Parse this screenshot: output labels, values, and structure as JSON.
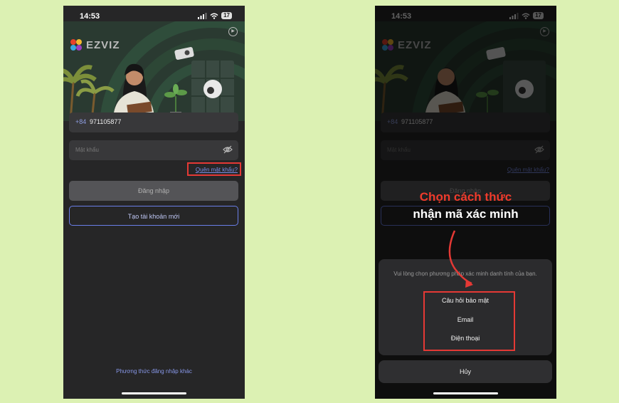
{
  "status": {
    "time": "14:53",
    "battery": "17"
  },
  "brand": {
    "name": "EZVIZ"
  },
  "login": {
    "country_code": "+84",
    "phone_number": "971105877",
    "password_placeholder": "Mật khẩu",
    "forgot_password": "Quên mật khẩu?",
    "login_button": "Đăng nhập",
    "create_account_button": "Tạo tài khoản mới",
    "other_login": "Phương thức đăng nhập khác"
  },
  "annotation": {
    "line1": "Chọn cách thức",
    "line2": "nhận mã xác minh"
  },
  "verify_sheet": {
    "message": "Vui lòng chọn phương pháp xác minh danh tính của bạn.",
    "options": [
      "Câu hỏi bảo mật",
      "Email",
      "Điện thoại"
    ],
    "cancel": "Hủy"
  },
  "colors": {
    "highlight": "#e53935",
    "accent": "#7b8ee8",
    "page_bg": "#dcf1b3"
  }
}
